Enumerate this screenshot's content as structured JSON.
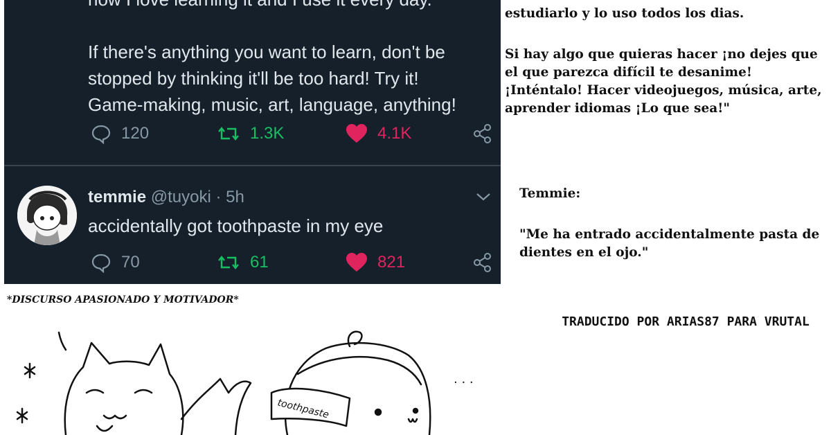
{
  "tweet1": {
    "text_partial_top": "now I love learning it and I use it every day.",
    "text": "If there's anything you want to learn, don't be\nstopped by thinking it'll be too hard! Try it!\nGame-making, music, art, language, anything!",
    "replies": "120",
    "retweets": "1.3K",
    "likes": "4.1K"
  },
  "reply_tweet": {
    "name": "temmie",
    "handle_time": " @tuyoki · 5h",
    "text": "accidentally got toothpaste in my eye",
    "replies": "70",
    "retweets": "61",
    "likes": "821"
  },
  "translation": {
    "p1": "estudiarlo y lo uso todos los dias.",
    "p2": "Si hay algo que quieras hacer ¡no dejes que el que parezca difícil te desanime! ¡Inténtalo! Hacer videojuegos, música, arte, aprender idiomas ¡Lo que sea!\"",
    "name": "Temmie:",
    "quote": "\"Me ha entrado accidentalmente pasta de dientes en el ojo.\""
  },
  "credit": "TRADUCIDO POR ARIAS87 PARA VRUTAL",
  "comic": {
    "caption": "*DISCURSO APASIONADO Y MOTIVADOR*",
    "toothpaste_label": "toothpaste",
    "dots": ". . ."
  },
  "colors": {
    "panel_bg": "#15202b",
    "text": "#e1e8ed",
    "muted": "#8899a6",
    "retweet": "#17bf63",
    "like": "#e0245e"
  }
}
